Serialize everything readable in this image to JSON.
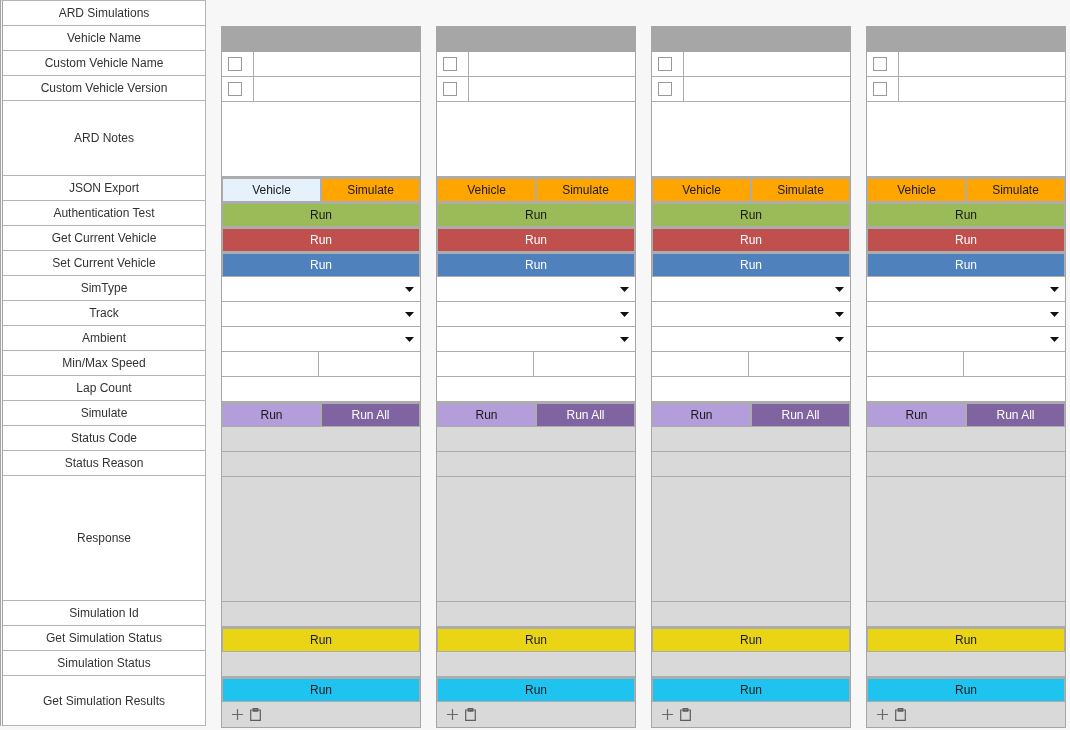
{
  "labels": [
    "ARD Simulations",
    "Vehicle Name",
    "Custom Vehicle Name",
    "Custom Vehicle Version",
    "ARD Notes",
    "JSON Export",
    "Authentication Test",
    "Get Current Vehicle",
    "Set Current Vehicle",
    "SimType",
    "Track",
    "Ambient",
    "Min/Max Speed",
    "Lap Count",
    "Simulate",
    "Status Code",
    "Status Reason",
    "Response",
    "Simulation Id",
    "Get Simulation Status",
    "Simulation Status",
    "Get Simulation Results"
  ],
  "vehicles": [
    {
      "rows": [
        {
          "kind": "header"
        },
        {
          "kind": "check_input",
          "checked": false
        },
        {
          "kind": "check_input",
          "checked": false
        },
        {
          "kind": "textarea"
        },
        {
          "kind": "buttons",
          "buttons": [
            {
              "label": "Vehicle",
              "color": "#e5f1fb"
            },
            {
              "label": "Simulate",
              "color": "#ffa500"
            }
          ]
        },
        {
          "kind": "buttons",
          "buttons": [
            {
              "label": "Run",
              "color": "#9bbb59"
            }
          ]
        },
        {
          "kind": "buttons",
          "buttons": [
            {
              "label": "Run",
              "color": "#c0504d"
            }
          ]
        },
        {
          "kind": "buttons",
          "buttons": [
            {
              "label": "Run",
              "color": "#4f81bd"
            }
          ]
        },
        {
          "kind": "dropdown"
        },
        {
          "kind": "dropdown"
        },
        {
          "kind": "dropdown"
        },
        {
          "kind": "input_pair"
        },
        {
          "kind": "input"
        },
        {
          "kind": "buttons",
          "buttons": [
            {
              "label": "Run",
              "color": "#b39ddb"
            },
            {
              "label": "Run All",
              "color": "#8064a2"
            }
          ]
        },
        {
          "kind": "output"
        },
        {
          "kind": "output"
        },
        {
          "kind": "response"
        },
        {
          "kind": "output"
        },
        {
          "kind": "buttons",
          "buttons": [
            {
              "label": "Run",
              "color": "#e9d416"
            }
          ]
        },
        {
          "kind": "output"
        },
        {
          "kind": "result_buttons",
          "buttons": [
            {
              "label": "Run",
              "color": "#1ec4ef"
            }
          ]
        }
      ]
    },
    {
      "rows": [
        {
          "kind": "header"
        },
        {
          "kind": "check_input",
          "checked": false
        },
        {
          "kind": "check_input",
          "checked": false
        },
        {
          "kind": "textarea"
        },
        {
          "kind": "buttons",
          "buttons": [
            {
              "label": "Vehicle",
              "color": "#ffa500"
            },
            {
              "label": "Simulate",
              "color": "#ffa500"
            }
          ]
        },
        {
          "kind": "buttons",
          "buttons": [
            {
              "label": "Run",
              "color": "#9bbb59"
            }
          ]
        },
        {
          "kind": "buttons",
          "buttons": [
            {
              "label": "Run",
              "color": "#c0504d"
            }
          ]
        },
        {
          "kind": "buttons",
          "buttons": [
            {
              "label": "Run",
              "color": "#4f81bd"
            }
          ]
        },
        {
          "kind": "dropdown"
        },
        {
          "kind": "dropdown"
        },
        {
          "kind": "dropdown"
        },
        {
          "kind": "input_pair"
        },
        {
          "kind": "input"
        },
        {
          "kind": "buttons",
          "buttons": [
            {
              "label": "Run",
              "color": "#b39ddb"
            },
            {
              "label": "Run All",
              "color": "#8064a2"
            }
          ]
        },
        {
          "kind": "output"
        },
        {
          "kind": "output"
        },
        {
          "kind": "response"
        },
        {
          "kind": "output"
        },
        {
          "kind": "buttons",
          "buttons": [
            {
              "label": "Run",
              "color": "#e9d416"
            }
          ]
        },
        {
          "kind": "output"
        },
        {
          "kind": "result_buttons",
          "buttons": [
            {
              "label": "Run",
              "color": "#1ec4ef"
            }
          ]
        }
      ]
    },
    {
      "rows": [
        {
          "kind": "header"
        },
        {
          "kind": "check_input",
          "checked": false
        },
        {
          "kind": "check_input",
          "checked": false
        },
        {
          "kind": "textarea"
        },
        {
          "kind": "buttons",
          "buttons": [
            {
              "label": "Vehicle",
              "color": "#ffa500"
            },
            {
              "label": "Simulate",
              "color": "#ffa500"
            }
          ]
        },
        {
          "kind": "buttons",
          "buttons": [
            {
              "label": "Run",
              "color": "#9bbb59"
            }
          ]
        },
        {
          "kind": "buttons",
          "buttons": [
            {
              "label": "Run",
              "color": "#c0504d"
            }
          ]
        },
        {
          "kind": "buttons",
          "buttons": [
            {
              "label": "Run",
              "color": "#4f81bd"
            }
          ]
        },
        {
          "kind": "dropdown"
        },
        {
          "kind": "dropdown"
        },
        {
          "kind": "dropdown"
        },
        {
          "kind": "input_pair"
        },
        {
          "kind": "input"
        },
        {
          "kind": "buttons",
          "buttons": [
            {
              "label": "Run",
              "color": "#b39ddb"
            },
            {
              "label": "Run All",
              "color": "#8064a2"
            }
          ]
        },
        {
          "kind": "output"
        },
        {
          "kind": "output"
        },
        {
          "kind": "response"
        },
        {
          "kind": "output"
        },
        {
          "kind": "buttons",
          "buttons": [
            {
              "label": "Run",
              "color": "#e9d416"
            }
          ]
        },
        {
          "kind": "output"
        },
        {
          "kind": "result_buttons",
          "buttons": [
            {
              "label": "Run",
              "color": "#1ec4ef"
            }
          ]
        }
      ]
    },
    {
      "rows": [
        {
          "kind": "header"
        },
        {
          "kind": "check_input",
          "checked": false
        },
        {
          "kind": "check_input",
          "checked": false
        },
        {
          "kind": "textarea"
        },
        {
          "kind": "buttons",
          "buttons": [
            {
              "label": "Vehicle",
              "color": "#ffa500"
            },
            {
              "label": "Simulate",
              "color": "#ffa500"
            }
          ]
        },
        {
          "kind": "buttons",
          "buttons": [
            {
              "label": "Run",
              "color": "#9bbb59"
            }
          ]
        },
        {
          "kind": "buttons",
          "buttons": [
            {
              "label": "Run",
              "color": "#c0504d"
            }
          ]
        },
        {
          "kind": "buttons",
          "buttons": [
            {
              "label": "Run",
              "color": "#4f81bd"
            }
          ]
        },
        {
          "kind": "dropdown"
        },
        {
          "kind": "dropdown"
        },
        {
          "kind": "dropdown"
        },
        {
          "kind": "input_pair"
        },
        {
          "kind": "input"
        },
        {
          "kind": "buttons",
          "buttons": [
            {
              "label": "Run",
              "color": "#b39ddb"
            },
            {
              "label": "Run All",
              "color": "#8064a2"
            }
          ]
        },
        {
          "kind": "output"
        },
        {
          "kind": "output"
        },
        {
          "kind": "response"
        },
        {
          "kind": "output"
        },
        {
          "kind": "buttons",
          "buttons": [
            {
              "label": "Run",
              "color": "#e9d416"
            }
          ]
        },
        {
          "kind": "output"
        },
        {
          "kind": "result_buttons",
          "buttons": [
            {
              "label": "Run",
              "color": "#1ec4ef"
            }
          ]
        }
      ]
    }
  ]
}
